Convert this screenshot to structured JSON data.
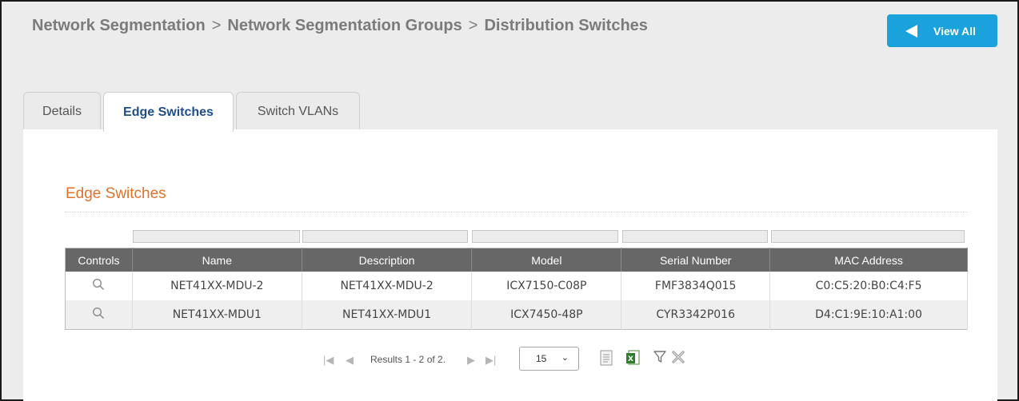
{
  "breadcrumb": {
    "items": [
      "Network Segmentation",
      "Network Segmentation Groups",
      "Distribution Switches"
    ],
    "separator": ">"
  },
  "header": {
    "view_all_label": "View All"
  },
  "tabs": [
    {
      "label": "Details",
      "active": false
    },
    {
      "label": "Edge Switches",
      "active": true
    },
    {
      "label": "Switch VLANs",
      "active": false
    }
  ],
  "section": {
    "title": "Edge Switches"
  },
  "table": {
    "columns": [
      "Controls",
      "Name",
      "Description",
      "Model",
      "Serial Number",
      "MAC Address"
    ],
    "rows": [
      {
        "name": "NET41XX-MDU-2",
        "description": "NET41XX-MDU-2",
        "model": "ICX7150-C08P",
        "serial": "FMF3834Q015",
        "mac": "C0:C5:20:B0:C4:F5"
      },
      {
        "name": "NET41XX-MDU1",
        "description": "NET41XX-MDU1",
        "model": "ICX7450-48P",
        "serial": "CYR3342P016",
        "mac": "D4:C1:9E:10:A1:00"
      }
    ]
  },
  "pager": {
    "results_text": "Results 1 - 2 of 2.",
    "page_size": "15"
  },
  "colors": {
    "accent": "#1aa2dd",
    "section_title": "#e0722a",
    "table_header": "#676767",
    "active_tab_text": "#1f4e8c"
  }
}
